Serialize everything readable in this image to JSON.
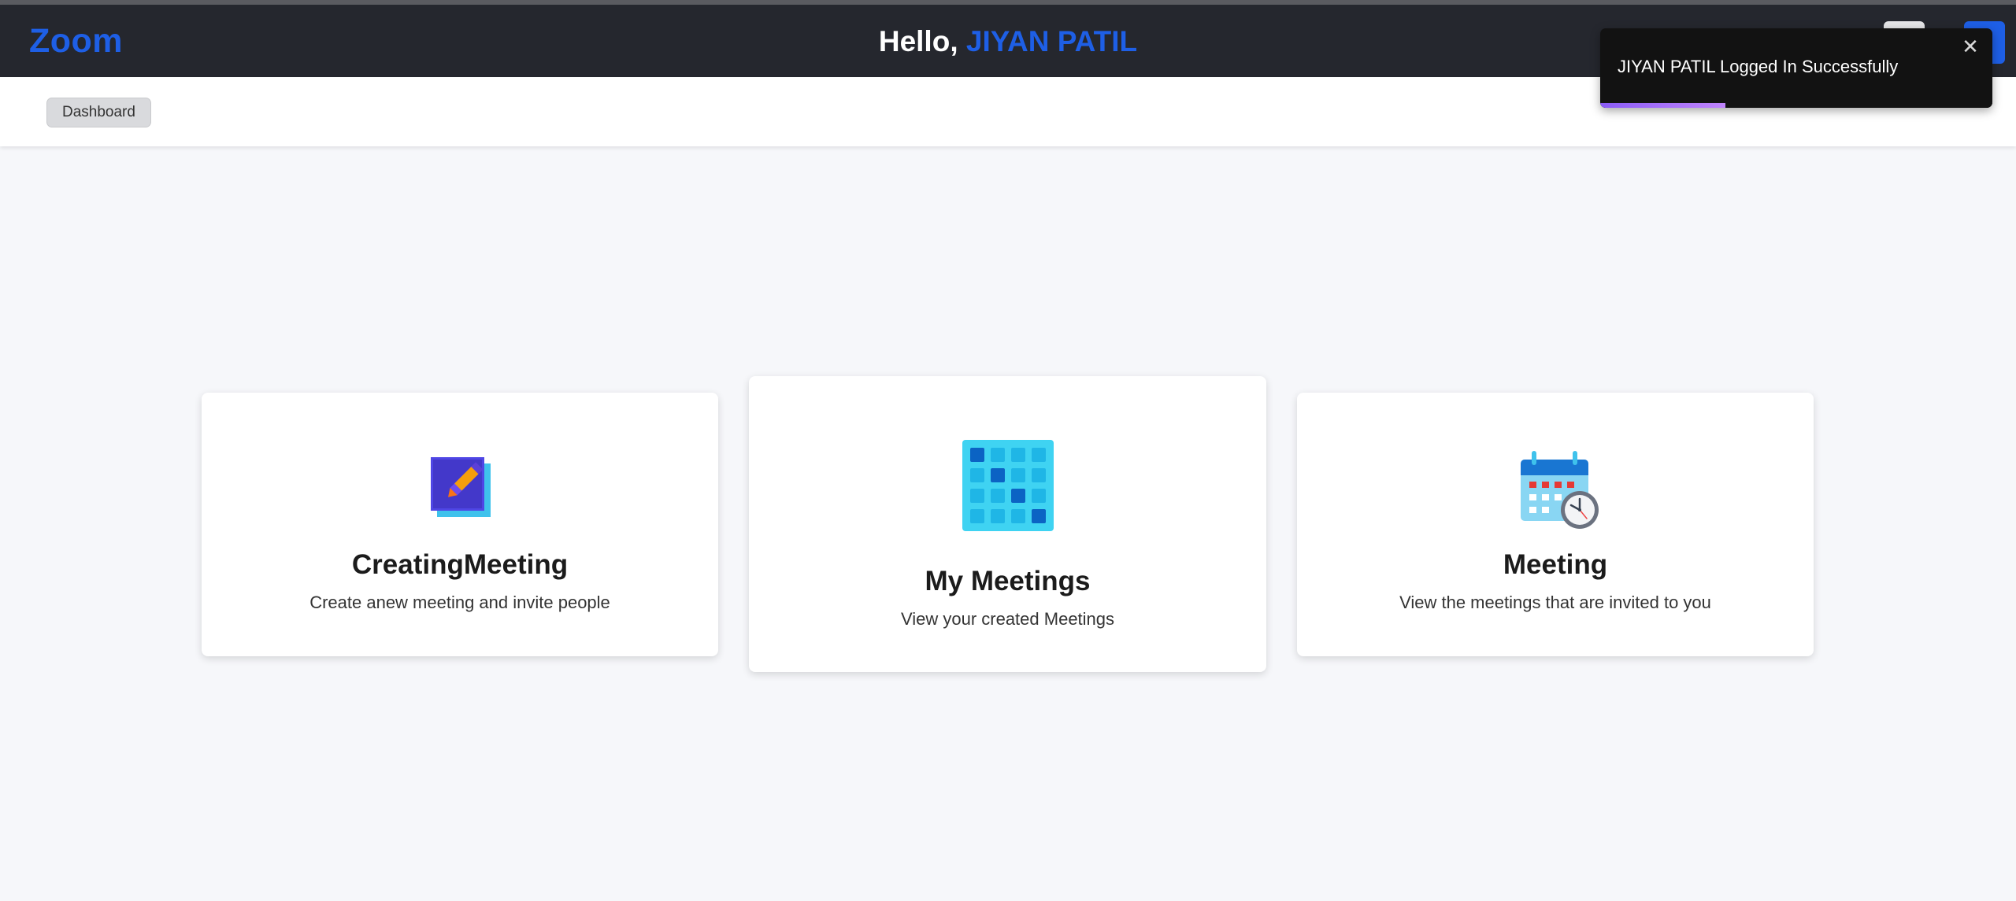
{
  "header": {
    "logo": "Zoom",
    "greeting_prefix": "Hello, ",
    "user_name": "JIYAN PATIL"
  },
  "breadcrumb": {
    "label": "Dashboard"
  },
  "toast": {
    "message": "JIYAN PATIL Logged In Successfully",
    "close_symbol": "✕",
    "progress_fraction": 0.32
  },
  "cards": [
    {
      "title": "CreatingMeeting",
      "description": "Create anew meeting and invite people",
      "icon": "edit-meeting-icon"
    },
    {
      "title": "My Meetings",
      "description": "View your created Meetings",
      "icon": "calendar-grid-icon"
    },
    {
      "title": "Meeting",
      "description": "View the meetings that are invited to you",
      "icon": "calendar-clock-icon"
    }
  ],
  "colors": {
    "brand": "#1e5fe6",
    "header_bg": "#25272e",
    "page_bg": "#f6f7fa",
    "toast_bg": "#121212",
    "toast_progress": "#a36bf2"
  }
}
